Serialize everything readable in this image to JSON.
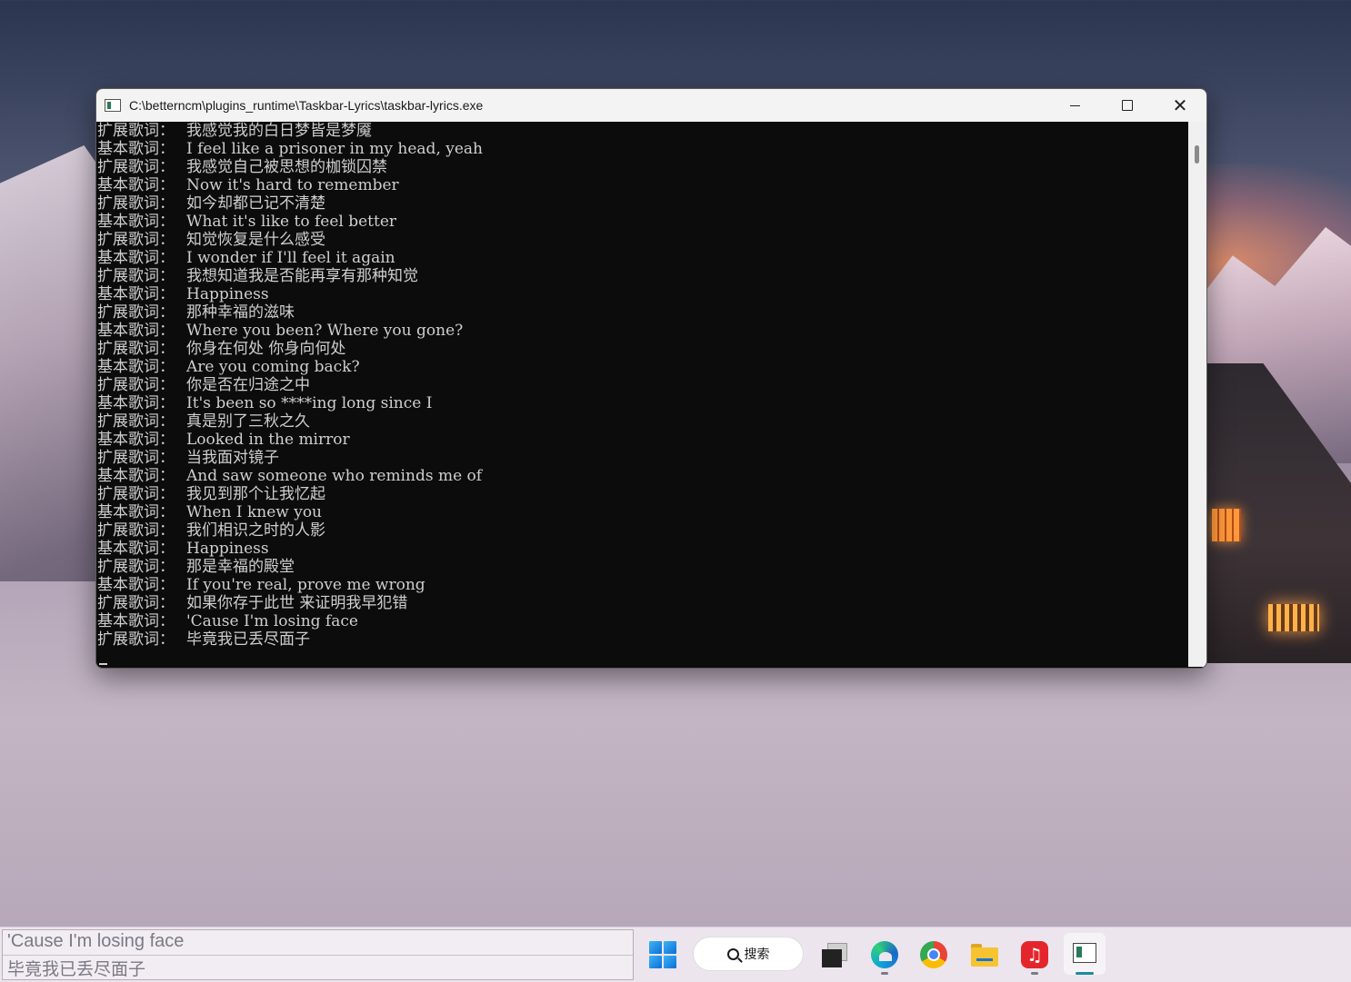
{
  "window": {
    "title": "C:\\betterncm\\plugins_runtime\\Taskbar-Lyrics\\taskbar-lyrics.exe",
    "controls": {
      "minimize": "",
      "maximize": "",
      "close": "✕"
    }
  },
  "console": {
    "lines": [
      {
        "label": "扩展歌词：",
        "text": "我感觉我的白日梦皆是梦魇"
      },
      {
        "label": "基本歌词：",
        "text": "I feel like a prisoner in my head, yeah"
      },
      {
        "label": "扩展歌词：",
        "text": "我感觉自己被思想的枷锁囚禁"
      },
      {
        "label": "基本歌词：",
        "text": "Now it's hard to remember"
      },
      {
        "label": "扩展歌词：",
        "text": "如今却都已记不清楚"
      },
      {
        "label": "基本歌词：",
        "text": "What it's like to feel better"
      },
      {
        "label": "扩展歌词：",
        "text": "知觉恢复是什么感受"
      },
      {
        "label": "基本歌词：",
        "text": "I wonder if I'll feel it again"
      },
      {
        "label": "扩展歌词：",
        "text": "我想知道我是否能再享有那种知觉"
      },
      {
        "label": "基本歌词：",
        "text": "Happiness"
      },
      {
        "label": "扩展歌词：",
        "text": "那种幸福的滋味"
      },
      {
        "label": "基本歌词：",
        "text": "Where you been? Where you gone?"
      },
      {
        "label": "扩展歌词：",
        "text": "你身在何处 你身向何处"
      },
      {
        "label": "基本歌词：",
        "text": "Are you coming back?"
      },
      {
        "label": "扩展歌词：",
        "text": "你是否在归途之中"
      },
      {
        "label": "基本歌词：",
        "text": "It's been so ****ing long since I"
      },
      {
        "label": "扩展歌词：",
        "text": "真是别了三秋之久"
      },
      {
        "label": "基本歌词：",
        "text": "Looked in the mirror"
      },
      {
        "label": "扩展歌词：",
        "text": "当我面对镜子"
      },
      {
        "label": "基本歌词：",
        "text": "And saw someone who reminds me of"
      },
      {
        "label": "扩展歌词：",
        "text": "我见到那个让我忆起"
      },
      {
        "label": "基本歌词：",
        "text": "When I knew you"
      },
      {
        "label": "扩展歌词：",
        "text": "我们相识之时的人影"
      },
      {
        "label": "基本歌词：",
        "text": "Happiness"
      },
      {
        "label": "扩展歌词：",
        "text": "那是幸福的殿堂"
      },
      {
        "label": "基本歌词：",
        "text": "If you're real, prove me wrong"
      },
      {
        "label": "扩展歌词：",
        "text": "如果你存于此世 来证明我早犯错"
      },
      {
        "label": "基本歌词：",
        "text": "'Cause I'm losing face"
      },
      {
        "label": "扩展歌词：",
        "text": "毕竟我已丢尽面子"
      }
    ]
  },
  "taskbar": {
    "lyrics": {
      "main": "'Cause I'm losing face",
      "sub": "毕竟我已丢尽面子"
    },
    "search_label": "搜索",
    "icons": [
      "start-icon",
      "search-icon",
      "task-view-icon",
      "edge-icon",
      "chrome-icon",
      "file-explorer-icon",
      "netease-music-icon",
      "console-app-icon"
    ]
  },
  "colors": {
    "console_bg": "#0c0c0c",
    "console_text": "#cfcfcf",
    "titlebar_bg": "#f3f3f3",
    "taskbar_bg": "#ece5ed"
  }
}
